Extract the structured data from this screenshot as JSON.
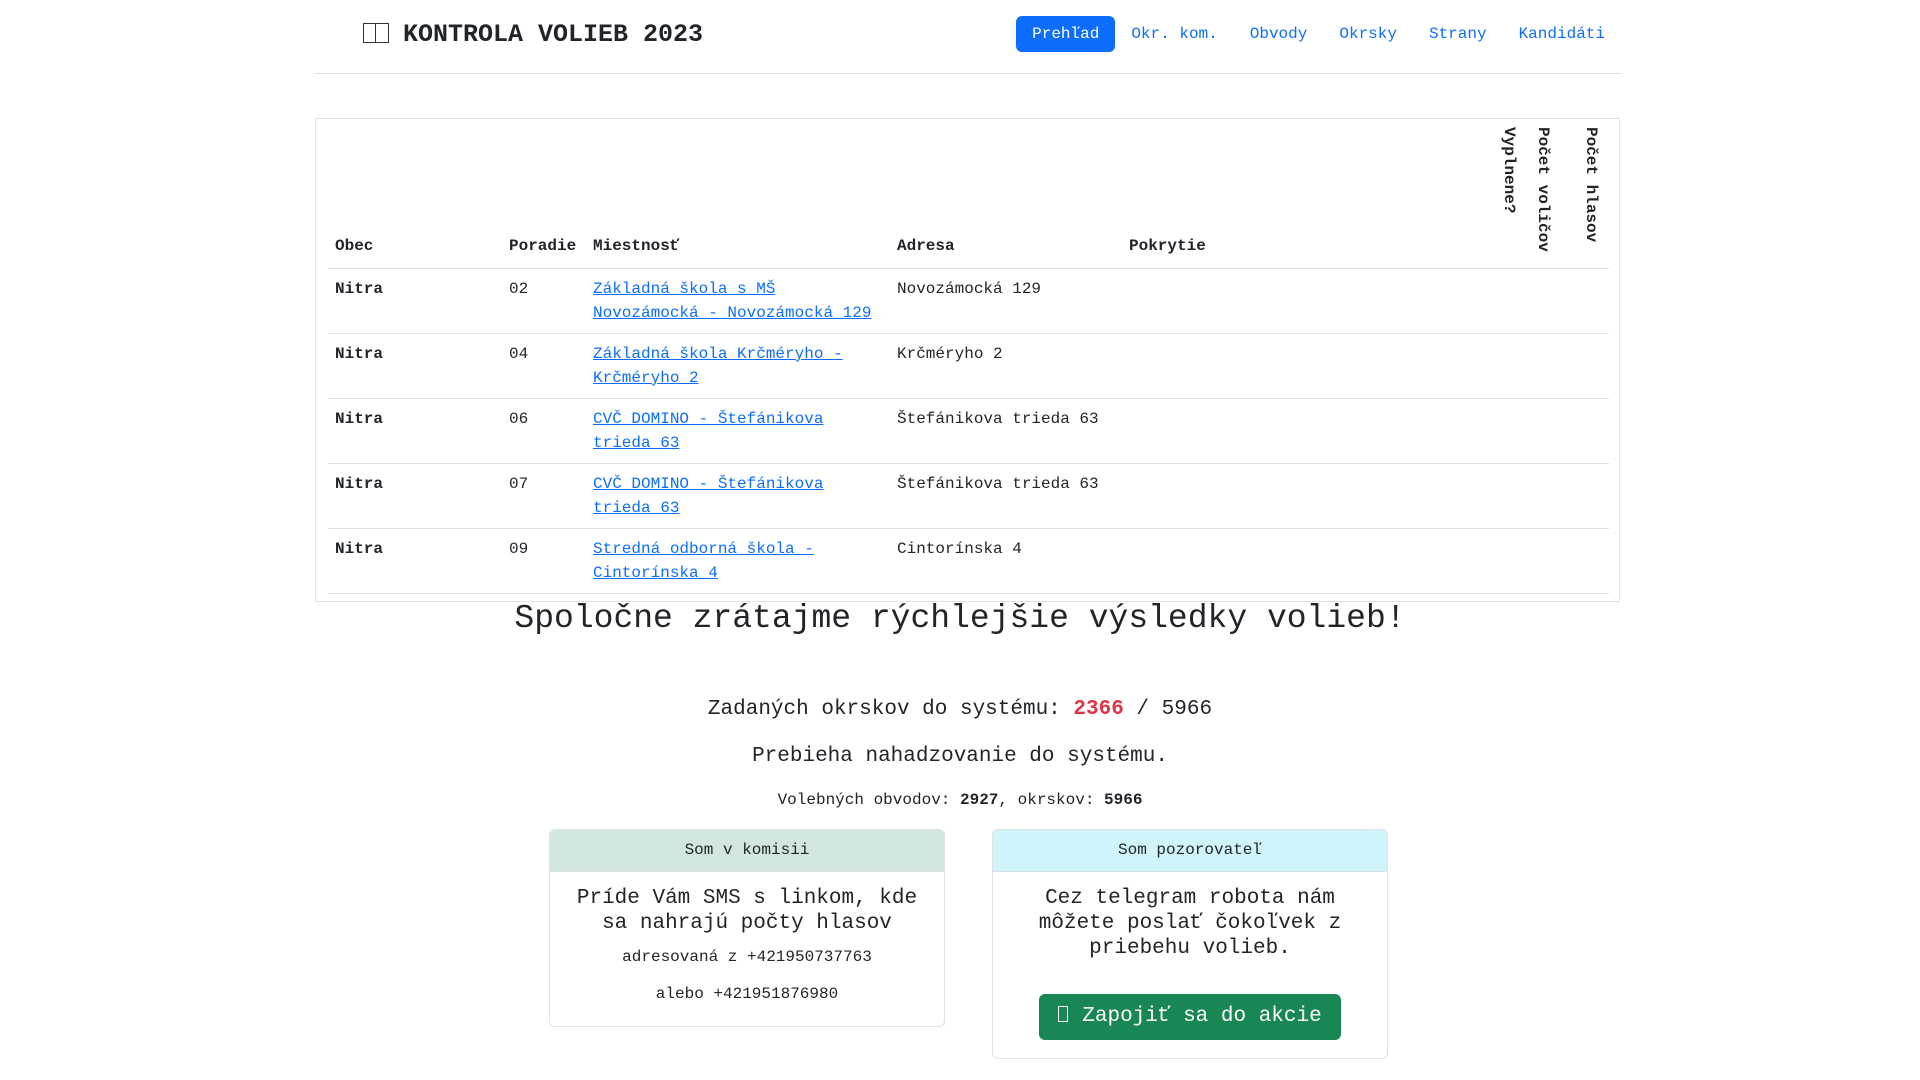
{
  "header": {
    "brand_flag_icon": "flag-icon",
    "brand_title": "KONTROLA VOLIEB 2023",
    "nav": [
      {
        "label": "Prehľad",
        "active": true
      },
      {
        "label": "Okr. kom.",
        "active": false
      },
      {
        "label": "Obvody",
        "active": false
      },
      {
        "label": "Okrsky",
        "active": false
      },
      {
        "label": "Strany",
        "active": false
      },
      {
        "label": "Kandidáti",
        "active": false
      }
    ]
  },
  "table": {
    "columns": {
      "obec": "Obec",
      "poradie": "Poradie",
      "miestnost": "Miestnosť",
      "adresa": "Adresa",
      "pokrytie": "Pokrytie",
      "vyplnene": "Vyplnene?",
      "pocet_volicov": "Počet voličov",
      "pocet_hlasov": "Počet hlasov"
    },
    "rows": [
      {
        "obec": "Nitra",
        "poradie": "02",
        "miestnost": "Základná škola s MŠ Novozámocká - Novozámocká 129",
        "adresa": "Novozámocká 129"
      },
      {
        "obec": "Nitra",
        "poradie": "04",
        "miestnost": "Základná škola Krčméryho - Krčméryho 2",
        "adresa": "Krčméryho 2"
      },
      {
        "obec": "Nitra",
        "poradie": "06",
        "miestnost": "CVČ DOMINO - Štefánikova trieda 63",
        "adresa": "Štefánikova trieda 63"
      },
      {
        "obec": "Nitra",
        "poradie": "07",
        "miestnost": "CVČ DOMINO - Štefánikova trieda 63",
        "adresa": "Štefánikova trieda 63"
      },
      {
        "obec": "Nitra",
        "poradie": "09",
        "miestnost": "Stredná odborná škola - Cintorínska 4",
        "adresa": "Cintorínska 4"
      }
    ]
  },
  "hero": {
    "title": "Spoločne zrátajme rýchlejšie výsledky volieb!",
    "entered_label": "Zadaných okrskov do systému:",
    "entered_count": "2366",
    "entered_separator": "/",
    "entered_total": "5966",
    "status": "Prebieha nahadzovanie do systému.",
    "districts_label": "Volebných obvodov:",
    "districts_count": "2927",
    "precincts_label": ", okrskov:",
    "precincts_count": "5966"
  },
  "cards": {
    "commission": {
      "header": "Som v komisii",
      "lead": "Príde Vám SMS s linkom, kde sa nahrajú počty hlasov",
      "line1": "adresovaná z +421950737763",
      "line2": "alebo +421951876980"
    },
    "observer": {
      "header": "Som pozorovateľ",
      "lead": "Cez telegram robota nám môžete poslať čokoľvek z priebehu volieb.",
      "button_icon": "telegram-icon",
      "button_label": "Zapojiť sa do akcie"
    }
  },
  "colors": {
    "primary": "#0d6efd",
    "danger": "#dc3545",
    "success": "#198754",
    "success_light": "#d1e7dd",
    "info_light": "#cff4fc"
  }
}
